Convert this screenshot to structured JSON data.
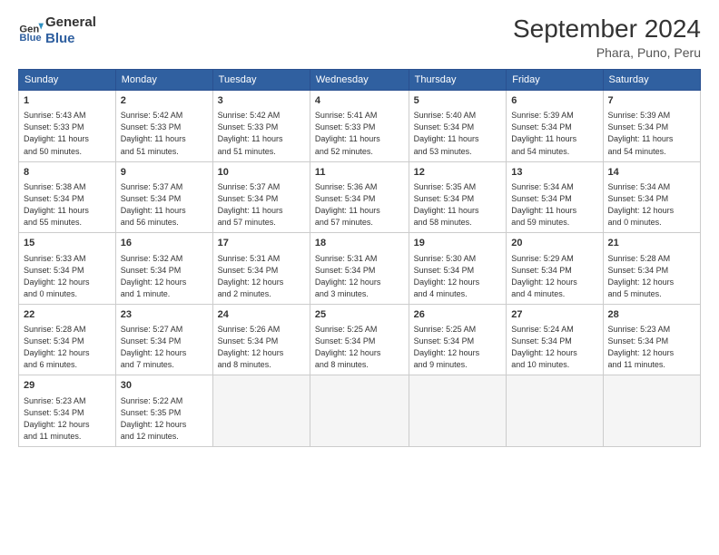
{
  "header": {
    "logo_line1": "General",
    "logo_line2": "Blue",
    "month_year": "September 2024",
    "location": "Phara, Puno, Peru"
  },
  "days_of_week": [
    "Sunday",
    "Monday",
    "Tuesday",
    "Wednesday",
    "Thursday",
    "Friday",
    "Saturday"
  ],
  "weeks": [
    [
      {
        "num": "1",
        "info": "Sunrise: 5:43 AM\nSunset: 5:33 PM\nDaylight: 11 hours\nand 50 minutes."
      },
      {
        "num": "2",
        "info": "Sunrise: 5:42 AM\nSunset: 5:33 PM\nDaylight: 11 hours\nand 51 minutes."
      },
      {
        "num": "3",
        "info": "Sunrise: 5:42 AM\nSunset: 5:33 PM\nDaylight: 11 hours\nand 51 minutes."
      },
      {
        "num": "4",
        "info": "Sunrise: 5:41 AM\nSunset: 5:33 PM\nDaylight: 11 hours\nand 52 minutes."
      },
      {
        "num": "5",
        "info": "Sunrise: 5:40 AM\nSunset: 5:34 PM\nDaylight: 11 hours\nand 53 minutes."
      },
      {
        "num": "6",
        "info": "Sunrise: 5:39 AM\nSunset: 5:34 PM\nDaylight: 11 hours\nand 54 minutes."
      },
      {
        "num": "7",
        "info": "Sunrise: 5:39 AM\nSunset: 5:34 PM\nDaylight: 11 hours\nand 54 minutes."
      }
    ],
    [
      {
        "num": "8",
        "info": "Sunrise: 5:38 AM\nSunset: 5:34 PM\nDaylight: 11 hours\nand 55 minutes."
      },
      {
        "num": "9",
        "info": "Sunrise: 5:37 AM\nSunset: 5:34 PM\nDaylight: 11 hours\nand 56 minutes."
      },
      {
        "num": "10",
        "info": "Sunrise: 5:37 AM\nSunset: 5:34 PM\nDaylight: 11 hours\nand 57 minutes."
      },
      {
        "num": "11",
        "info": "Sunrise: 5:36 AM\nSunset: 5:34 PM\nDaylight: 11 hours\nand 57 minutes."
      },
      {
        "num": "12",
        "info": "Sunrise: 5:35 AM\nSunset: 5:34 PM\nDaylight: 11 hours\nand 58 minutes."
      },
      {
        "num": "13",
        "info": "Sunrise: 5:34 AM\nSunset: 5:34 PM\nDaylight: 11 hours\nand 59 minutes."
      },
      {
        "num": "14",
        "info": "Sunrise: 5:34 AM\nSunset: 5:34 PM\nDaylight: 12 hours\nand 0 minutes."
      }
    ],
    [
      {
        "num": "15",
        "info": "Sunrise: 5:33 AM\nSunset: 5:34 PM\nDaylight: 12 hours\nand 0 minutes."
      },
      {
        "num": "16",
        "info": "Sunrise: 5:32 AM\nSunset: 5:34 PM\nDaylight: 12 hours\nand 1 minute."
      },
      {
        "num": "17",
        "info": "Sunrise: 5:31 AM\nSunset: 5:34 PM\nDaylight: 12 hours\nand 2 minutes."
      },
      {
        "num": "18",
        "info": "Sunrise: 5:31 AM\nSunset: 5:34 PM\nDaylight: 12 hours\nand 3 minutes."
      },
      {
        "num": "19",
        "info": "Sunrise: 5:30 AM\nSunset: 5:34 PM\nDaylight: 12 hours\nand 4 minutes."
      },
      {
        "num": "20",
        "info": "Sunrise: 5:29 AM\nSunset: 5:34 PM\nDaylight: 12 hours\nand 4 minutes."
      },
      {
        "num": "21",
        "info": "Sunrise: 5:28 AM\nSunset: 5:34 PM\nDaylight: 12 hours\nand 5 minutes."
      }
    ],
    [
      {
        "num": "22",
        "info": "Sunrise: 5:28 AM\nSunset: 5:34 PM\nDaylight: 12 hours\nand 6 minutes."
      },
      {
        "num": "23",
        "info": "Sunrise: 5:27 AM\nSunset: 5:34 PM\nDaylight: 12 hours\nand 7 minutes."
      },
      {
        "num": "24",
        "info": "Sunrise: 5:26 AM\nSunset: 5:34 PM\nDaylight: 12 hours\nand 8 minutes."
      },
      {
        "num": "25",
        "info": "Sunrise: 5:25 AM\nSunset: 5:34 PM\nDaylight: 12 hours\nand 8 minutes."
      },
      {
        "num": "26",
        "info": "Sunrise: 5:25 AM\nSunset: 5:34 PM\nDaylight: 12 hours\nand 9 minutes."
      },
      {
        "num": "27",
        "info": "Sunrise: 5:24 AM\nSunset: 5:34 PM\nDaylight: 12 hours\nand 10 minutes."
      },
      {
        "num": "28",
        "info": "Sunrise: 5:23 AM\nSunset: 5:34 PM\nDaylight: 12 hours\nand 11 minutes."
      }
    ],
    [
      {
        "num": "29",
        "info": "Sunrise: 5:23 AM\nSunset: 5:34 PM\nDaylight: 12 hours\nand 11 minutes."
      },
      {
        "num": "30",
        "info": "Sunrise: 5:22 AM\nSunset: 5:35 PM\nDaylight: 12 hours\nand 12 minutes."
      },
      null,
      null,
      null,
      null,
      null
    ]
  ]
}
